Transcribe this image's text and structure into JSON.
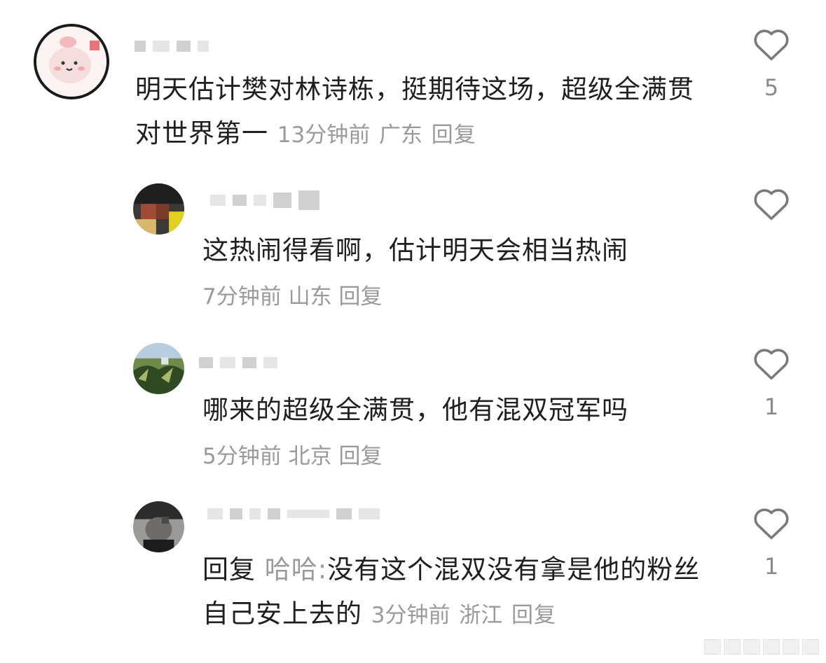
{
  "comments": [
    {
      "id": "c1",
      "username": "",
      "text": "明天估计樊对林诗栋，挺期待这场，超级全满贯对世界第一",
      "time": "13分钟前",
      "location": "广东",
      "reply_label": "回复",
      "likes": "5"
    },
    {
      "id": "c2",
      "username": "",
      "text": "这热闹得看啊，估计明天会相当热闹",
      "time": "7分钟前",
      "location": "山东",
      "reply_label": "回复",
      "likes": ""
    },
    {
      "id": "c3",
      "username": "",
      "text": "哪来的超级全满贯，他有混双冠军吗",
      "time": "5分钟前",
      "location": "北京",
      "reply_label": "回复",
      "likes": "1"
    },
    {
      "id": "c4",
      "username": "",
      "reply_prefix": "回复",
      "reply_to": "哈哈:",
      "text": "没有这个混双没有拿是他的粉丝自己安上去的",
      "time": "3分钟前",
      "location": "浙江",
      "reply_label": "回复",
      "likes": "1"
    }
  ],
  "icons": {
    "like": "heart-outline-icon"
  },
  "colors": {
    "text": "#1f1f1f",
    "meta": "#9a9a9a",
    "heart": "#7a7a7a"
  }
}
